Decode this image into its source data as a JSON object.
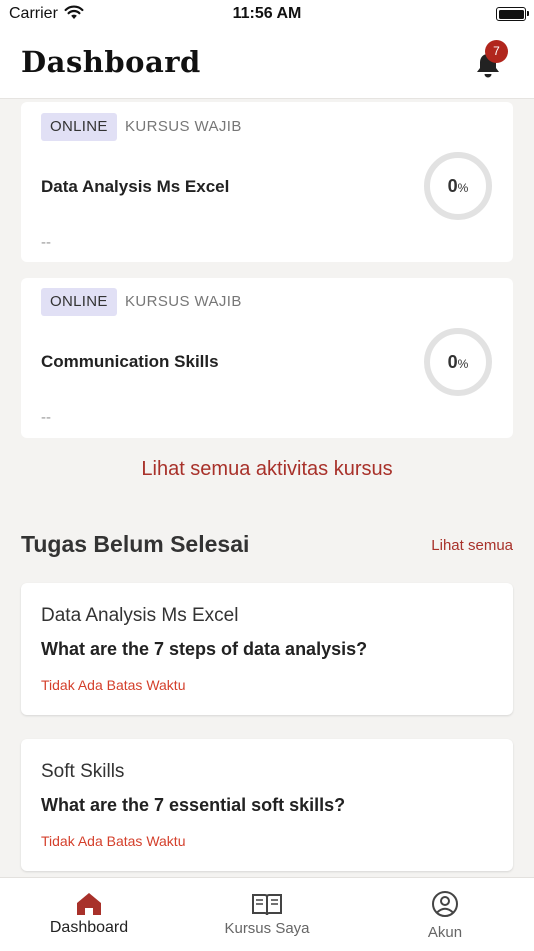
{
  "status_bar": {
    "carrier": "Carrier",
    "time": "11:56 AM"
  },
  "header": {
    "title": "Dashboard",
    "notification_count": "7"
  },
  "courses": [
    {
      "mode": "ONLINE",
      "type": "KURSUS WAJIB",
      "title": "Data Analysis Ms Excel",
      "subtitle": "--",
      "progress_value": "0",
      "progress_unit": "%"
    },
    {
      "mode": "ONLINE",
      "type": "KURSUS WAJIB",
      "title": "Communication Skills",
      "subtitle": "--",
      "progress_value": "0",
      "progress_unit": "%"
    }
  ],
  "see_all_activity": "Lihat semua aktivitas kursus",
  "tasks_section": {
    "title": "Tugas Belum Selesai",
    "see_all": "Lihat semua",
    "items": [
      {
        "course": "Data Analysis Ms Excel",
        "question": "What are the 7 steps of data analysis?",
        "deadline": "Tidak Ada Batas Waktu"
      },
      {
        "course": "Soft Skills",
        "question": "What are the 7 essential soft skills?",
        "deadline": "Tidak Ada Batas Waktu"
      }
    ]
  },
  "tabbar": {
    "items": [
      {
        "label": "Dashboard",
        "icon": "home-icon",
        "active": true
      },
      {
        "label": "Kursus Saya",
        "icon": "book-icon",
        "active": false
      },
      {
        "label": "Akun",
        "icon": "account-icon",
        "active": false
      }
    ]
  },
  "colors": {
    "accent": "#a8312a",
    "badge": "#b1261d",
    "deadline": "#d4402c",
    "tag_bg": "#e1e0f5",
    "background": "#f4f3f1"
  }
}
